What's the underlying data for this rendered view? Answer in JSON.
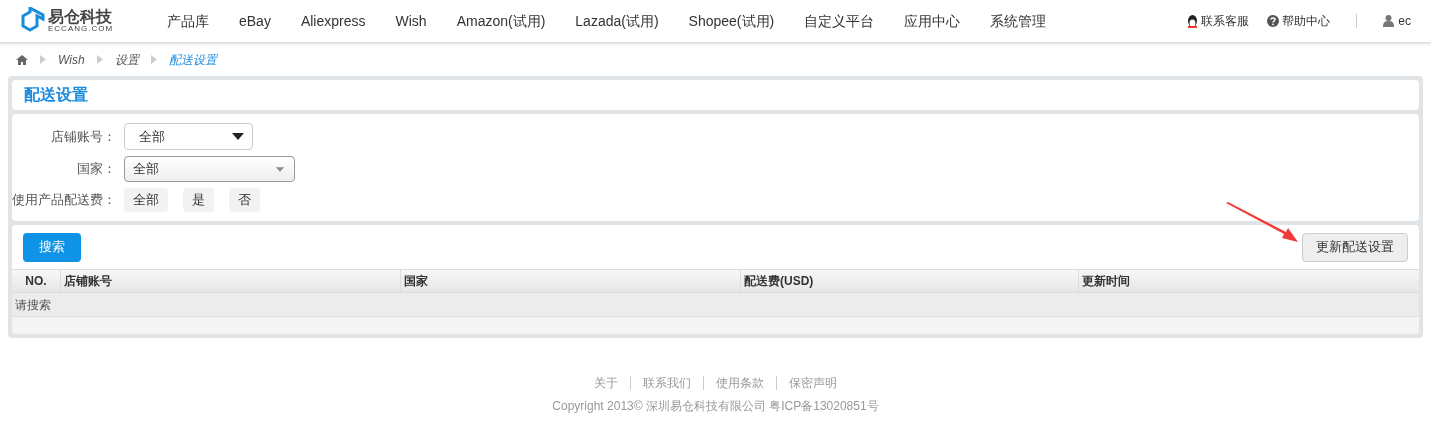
{
  "header": {
    "logo": {
      "name": "易仓科技",
      "domain": "ECCANG.COM"
    },
    "nav": [
      {
        "label": "产品库"
      },
      {
        "label": "eBay"
      },
      {
        "label": "Aliexpress"
      },
      {
        "label": "Wish"
      },
      {
        "label": "Amazon(试用)"
      },
      {
        "label": "Lazada(试用)"
      },
      {
        "label": "Shopee(试用)"
      },
      {
        "label": "自定义平台"
      },
      {
        "label": "应用中心"
      },
      {
        "label": "系统管理"
      }
    ],
    "support": "联系客服",
    "help": "帮助中心",
    "user": "ec"
  },
  "breadcrumb": [
    {
      "label": "Wish",
      "current": false
    },
    {
      "label": "设置",
      "current": false
    },
    {
      "label": "配送设置",
      "current": true
    }
  ],
  "page_title": "配送设置",
  "filters": [
    {
      "label": "店铺账号：",
      "kind": "select",
      "value": "全部"
    },
    {
      "label": "国家：",
      "kind": "native-select",
      "value": "全部"
    },
    {
      "label": "使用产品配送费：",
      "kind": "options",
      "options": [
        "全部",
        "是",
        "否"
      ]
    }
  ],
  "search_button": "搜索",
  "update_button": "更新配送设置",
  "table": {
    "columns": [
      "NO.",
      "店铺账号",
      "国家",
      "配送费(USD)",
      "更新时间"
    ],
    "empty_text": "请搜索"
  },
  "footer": {
    "links": [
      "关于",
      "联系我们",
      "使用条款",
      "保密声明"
    ],
    "copyright": "Copyright 2013© 深圳易仓科技有限公司 粤ICP备13020851号"
  }
}
